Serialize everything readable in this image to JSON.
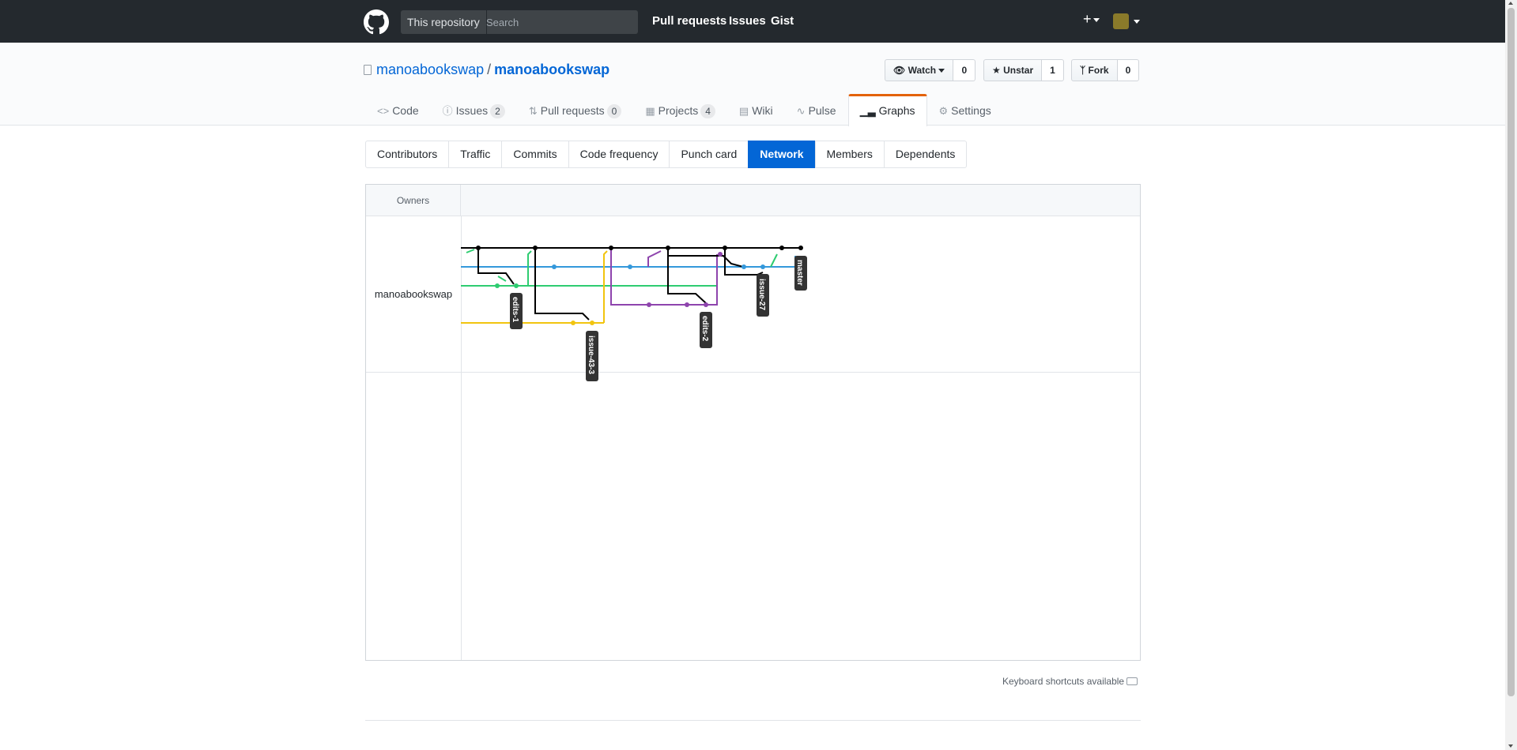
{
  "header": {
    "search_scope": "This repository",
    "search_placeholder": "Search",
    "nav": [
      "Pull requests",
      "Issues",
      "Gist"
    ],
    "new_icon": "plus-icon",
    "logo_icon": "github-logo-icon"
  },
  "repo": {
    "owner": "manoabookswap",
    "separator": "/",
    "name": "manoabookswap",
    "watch_label": "Watch",
    "watch_count": "0",
    "star_label": "Unstar",
    "star_count": "1",
    "fork_label": "Fork",
    "fork_count": "0"
  },
  "reponav": [
    {
      "label": "Code",
      "icon": "code-icon"
    },
    {
      "label": "Issues",
      "icon": "issue-icon",
      "count": "2"
    },
    {
      "label": "Pull requests",
      "icon": "pull-request-icon",
      "count": "0"
    },
    {
      "label": "Projects",
      "icon": "project-icon",
      "count": "4"
    },
    {
      "label": "Wiki",
      "icon": "book-icon"
    },
    {
      "label": "Pulse",
      "icon": "pulse-icon"
    },
    {
      "label": "Graphs",
      "icon": "graph-icon",
      "selected": true
    },
    {
      "label": "Settings",
      "icon": "gear-icon"
    }
  ],
  "subnav": [
    "Contributors",
    "Traffic",
    "Commits",
    "Code frequency",
    "Punch card",
    "Network",
    "Members",
    "Dependents"
  ],
  "subnav_selected": "Network",
  "network": {
    "owners_label": "Owners",
    "owner": "manoabookswap",
    "branches": [
      "edits-1",
      "issue-43-3",
      "edits-2",
      "issue-27",
      "master"
    ],
    "colors": {
      "master": "#000000",
      "blue": "#3498db",
      "green": "#2ecc71",
      "yellow": "#f1c40f",
      "purple": "#8e44ad"
    }
  },
  "footer": {
    "shortcuts": "Keyboard shortcuts available"
  }
}
